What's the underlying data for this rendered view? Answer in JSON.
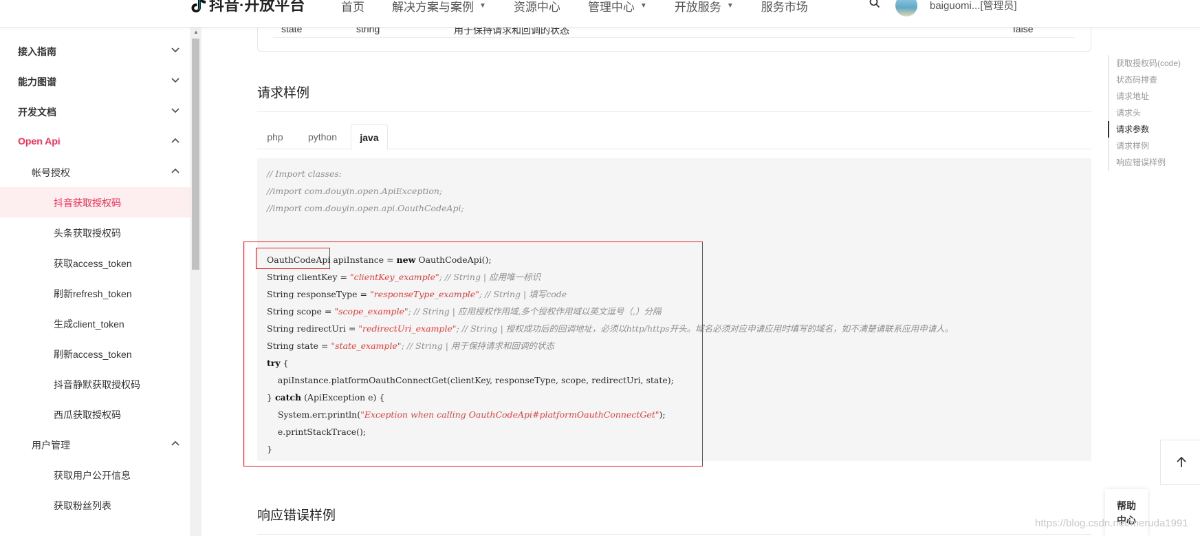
{
  "header": {
    "logo_text": "抖音·开放平台",
    "nav": [
      {
        "label": "首页",
        "has_caret": false
      },
      {
        "label": "解决方案与案例",
        "has_caret": true
      },
      {
        "label": "资源中心",
        "has_caret": false
      },
      {
        "label": "管理中心",
        "has_caret": true
      },
      {
        "label": "开放服务",
        "has_caret": true
      },
      {
        "label": "服务市场",
        "has_caret": false
      }
    ],
    "username": "baiguomi...[管理员]"
  },
  "sidebar": {
    "items": [
      {
        "label": "接入指南",
        "level": 1,
        "chevron": "down"
      },
      {
        "label": "能力图谱",
        "level": 1,
        "chevron": "down"
      },
      {
        "label": "开发文档",
        "level": 1,
        "chevron": "down"
      },
      {
        "label": "Open Api",
        "level": 1,
        "chevron": "up",
        "highlight": true
      },
      {
        "label": "帐号授权",
        "level": 2,
        "chevron": "up"
      },
      {
        "label": "抖音获取授权码",
        "level": 3,
        "active": true
      },
      {
        "label": "头条获取授权码",
        "level": 3
      },
      {
        "label": "获取access_token",
        "level": 3
      },
      {
        "label": "刷新refresh_token",
        "level": 3
      },
      {
        "label": "生成client_token",
        "level": 3
      },
      {
        "label": "刷新access_token",
        "level": 3
      },
      {
        "label": "抖音静默获取授权码",
        "level": 3
      },
      {
        "label": "西瓜获取授权码",
        "level": 3
      },
      {
        "label": "用户管理",
        "level": 2,
        "chevron": "up"
      },
      {
        "label": "获取用户公开信息",
        "level": 3
      },
      {
        "label": "获取粉丝列表",
        "level": 3
      }
    ]
  },
  "main": {
    "prev_row": {
      "name": "state",
      "type": "string",
      "desc": "用于保持请求和回调的状态",
      "required": "false"
    },
    "request_example_title": "请求样例",
    "tabs": [
      {
        "label": "php"
      },
      {
        "label": "python"
      },
      {
        "label": "java",
        "active": true
      }
    ],
    "code": {
      "comment_lines": [
        "// Import classes:",
        "//import com.douyin.open.ApiException;",
        "//import com.douyin.open.api.OauthCodeApi;"
      ],
      "line_instance": {
        "type": "OauthCodeApi",
        "rest_a": " apiInstance = ",
        "kw_new": "new",
        "rest_b": " OauthCodeApi();"
      },
      "params": [
        {
          "decl": "String clientKey = ",
          "str": "\"clientKey_example\"",
          "comment": "; // String | 应用唯一标识"
        },
        {
          "decl": "String responseType = ",
          "str": "\"responseType_example\"",
          "comment": "; // String | 填写code"
        },
        {
          "decl": "String scope = ",
          "str": "\"scope_example\"",
          "comment": "; // String | 应用授权作用域,多个授权作用域以英文逗号（,）分隔"
        },
        {
          "decl": "String redirectUri = ",
          "str": "\"redirectUri_example\"",
          "comment": "; // String | 授权成功后的回调地址，必须以http/https开头。域名必须对应申请应用时填写的域名，如不清楚请联系应用申请人。"
        },
        {
          "decl": "String state = ",
          "str": "\"state_example\"",
          "comment": "; // String | 用于保持请求和回调的状态"
        }
      ],
      "kw_try": "try",
      "try_open": " {",
      "call_line": "    apiInstance.platformOauthConnectGet(clientKey, responseType, scope, redirectUri, state);",
      "catch_pre": "} ",
      "kw_catch": "catch",
      "catch_rest": " (ApiException e) {",
      "err_pre": "    System.err.println(",
      "err_str": "\"Exception when calling OauthCodeApi#platformOauthConnectGet\"",
      "err_post": ");",
      "trace_line": "    e.printStackTrace();",
      "close_brace": "}"
    },
    "error_example_title": "响应错误样例"
  },
  "toc": {
    "items": [
      {
        "label": "获取授权码(code)"
      },
      {
        "label": "状态码排查"
      },
      {
        "label": "请求地址"
      },
      {
        "label": "请求头"
      },
      {
        "label": "请求参数",
        "active": true
      },
      {
        "label": "请求样例"
      },
      {
        "label": "响应错误样例"
      }
    ]
  },
  "help": {
    "line1": "帮助",
    "line2": "中心"
  },
  "watermark": "https://blog.csdn.net/meruda1991"
}
